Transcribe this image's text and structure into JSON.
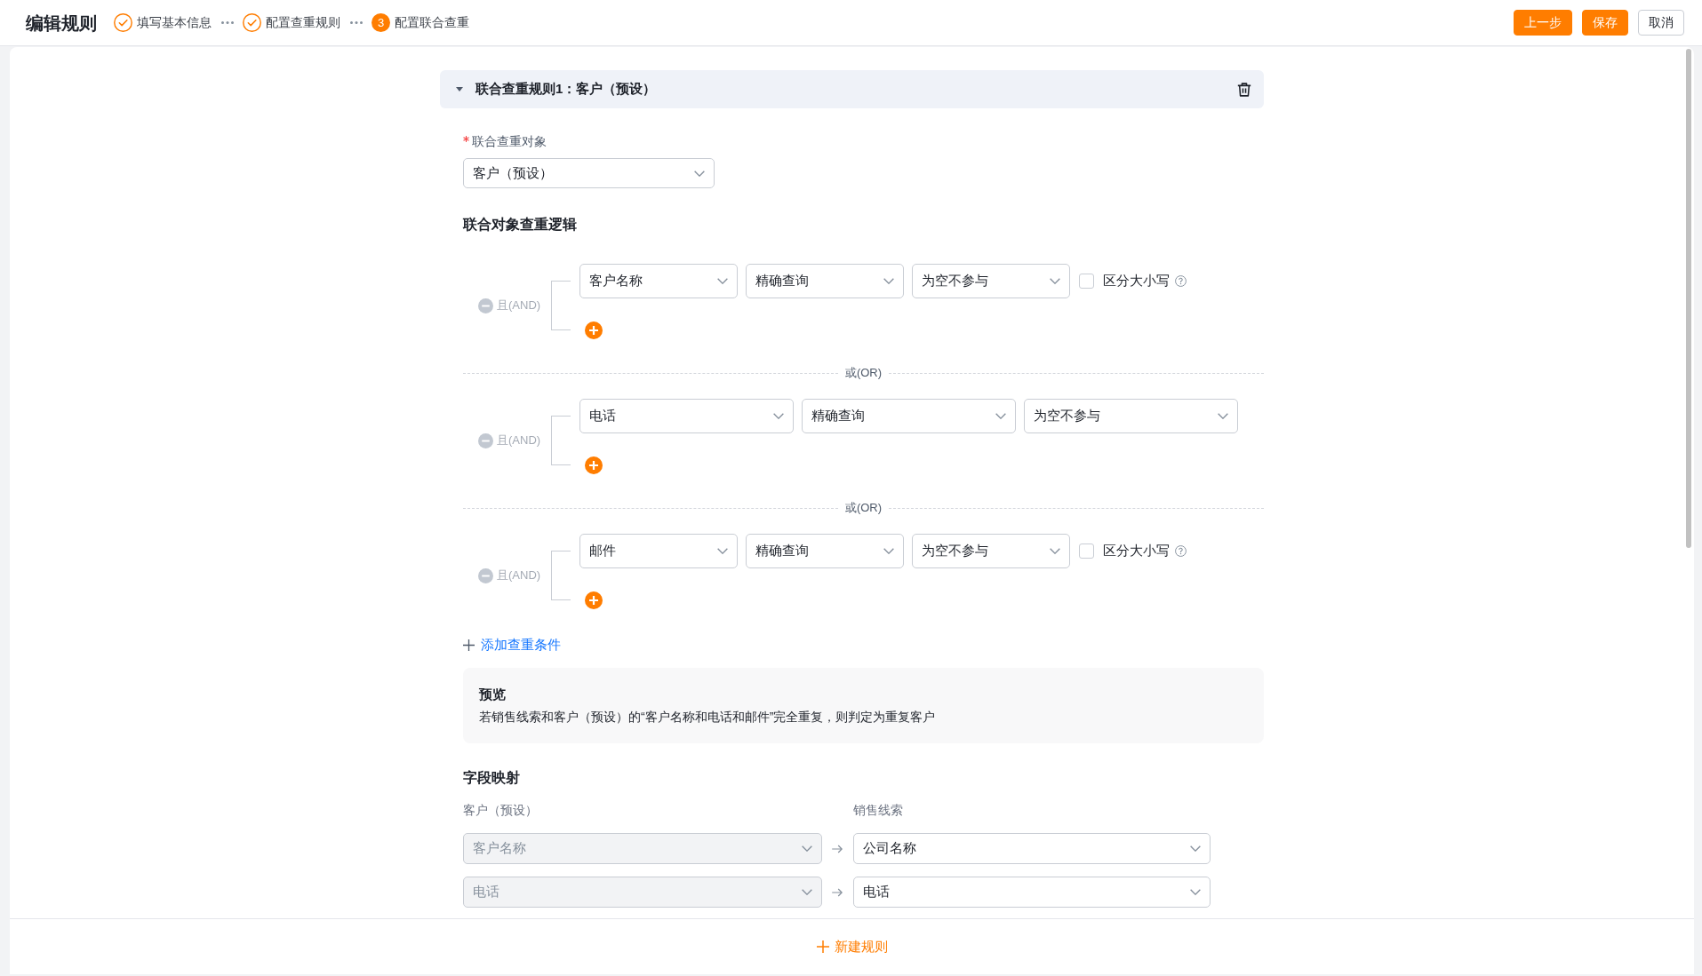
{
  "top_bar": {
    "title": "编辑规则",
    "steps": [
      {
        "kind": "done",
        "label": "填写基本信息"
      },
      {
        "kind": "done",
        "label": "配置查重规则"
      },
      {
        "kind": "current",
        "number": "3",
        "label": "配置联合查重"
      }
    ],
    "buttons": [
      {
        "kind": "primary",
        "label": "上一步"
      },
      {
        "kind": "primary",
        "label": "保存"
      },
      {
        "kind": "default",
        "label": "取消"
      }
    ]
  },
  "rules": [
    {
      "title": "联合查重规则1：客户（预设）",
      "expanded": true,
      "target_field": {
        "label": "联合查重对象",
        "required": true,
        "value": "客户（预设）"
      },
      "logic": {
        "title": "联合对象查重逻辑",
        "groups": [
          {
            "operator": "且(AND)",
            "conditions": [
              {
                "field": "客户名称",
                "match": "精确查询",
                "empty_rule": "为空不参与",
                "case_option": {
                  "label": "区分大小写",
                  "checked": false
                }
              }
            ]
          },
          {
            "separator": "或(OR)",
            "operator": "且(AND)",
            "conditions": [
              {
                "field": "电话",
                "match": "精确查询",
                "empty_rule": "为空不参与"
              }
            ]
          },
          {
            "separator": "或(OR)",
            "operator": "且(AND)",
            "conditions": [
              {
                "field": "邮件",
                "match": "精确查询",
                "empty_rule": "为空不参与",
                "case_option": {
                  "label": "区分大小写",
                  "checked": false
                }
              }
            ]
          }
        ],
        "add_condition": "添加查重条件"
      },
      "preview": {
        "title": "预览",
        "text": "若销售线索和客户（预设）的“客户名称和电话和邮件”完全重复，则判定为重复客户"
      },
      "field_mapping": {
        "title": "字段映射",
        "columns": [
          "客户（预设）",
          "销售线索"
        ],
        "rows": [
          {
            "source": {
              "value": "客户名称",
              "disabled": true
            },
            "target": {
              "value": "公司名称",
              "disabled": false
            }
          },
          {
            "source": {
              "value": "电话",
              "disabled": true
            },
            "target": {
              "value": "电话",
              "disabled": false
            }
          }
        ]
      }
    }
  ],
  "new_rule_button": "新建规则"
}
